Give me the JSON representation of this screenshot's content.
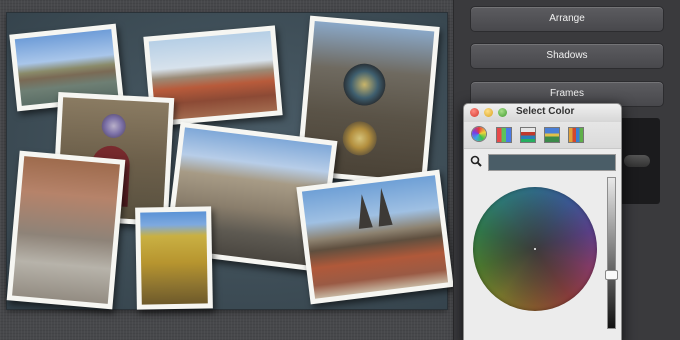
{
  "right_panel": {
    "buttons": {
      "arrange": "Arrange",
      "shadows": "Shadows",
      "frames": "Frames"
    }
  },
  "color_window": {
    "title": "Select Color",
    "current_color": "#4a5d67",
    "toolbar_icons": [
      "color-wheel-icon",
      "color-sliders-icon",
      "color-palettes-icon",
      "image-palettes-icon",
      "crayons-icon"
    ],
    "brightness_level": 0.65
  },
  "canvas": {
    "background_color": "#435560",
    "photos": [
      "photo-1",
      "photo-2",
      "photo-3",
      "photo-4",
      "photo-5",
      "photo-6",
      "photo-7",
      "photo-8",
      "photo-9"
    ]
  }
}
